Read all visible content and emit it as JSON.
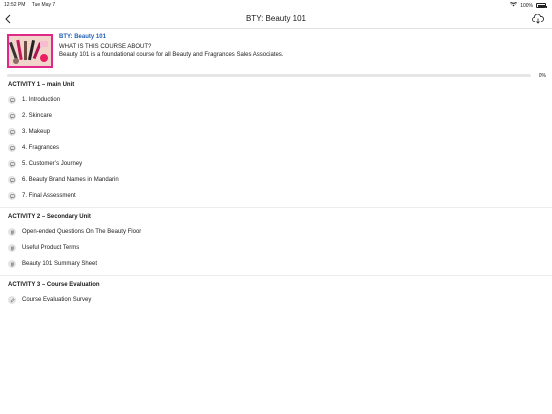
{
  "status_bar": {
    "time": "12:52 PM",
    "date": "Tue May 7",
    "battery": "100%"
  },
  "nav": {
    "title": "BTY: Beauty 101"
  },
  "course": {
    "title": "BTY: Beauty 101",
    "question": "WHAT IS THIS COURSE ABOUT?",
    "description": "Beauty 101 is a foundational course for all Beauty and Fragrances Sales Associates.",
    "progress_label": "0%",
    "progress_fraction": 0
  },
  "activities": [
    {
      "title": "ACTIVITY 1 – main Unit",
      "items": [
        {
          "label": "1. Introduction",
          "icon": "chat-icon"
        },
        {
          "label": "2. Skincare",
          "icon": "chat-icon"
        },
        {
          "label": "3. Makeup",
          "icon": "chat-icon"
        },
        {
          "label": "4. Fragrances",
          "icon": "chat-icon"
        },
        {
          "label": "5. Customer’s Journey",
          "icon": "chat-icon"
        },
        {
          "label": "6. Beauty Brand Names in Mandarin",
          "icon": "chat-icon"
        },
        {
          "label": "7. Final Assessment",
          "icon": "chat-icon"
        }
      ]
    },
    {
      "title": "ACTIVITY 2 – Secondary Unit",
      "items": [
        {
          "label": "Open-ended Questions On The Beauty Floor",
          "icon": "document-icon"
        },
        {
          "label": "Useful Product Terms",
          "icon": "document-icon"
        },
        {
          "label": "Beauty 101 Summary Sheet",
          "icon": "document-icon"
        }
      ]
    },
    {
      "title": "ACTIVITY 3 – Course Evaluation",
      "items": [
        {
          "label": "Course Evaluation Survey",
          "icon": "pencil-icon"
        }
      ]
    }
  ]
}
